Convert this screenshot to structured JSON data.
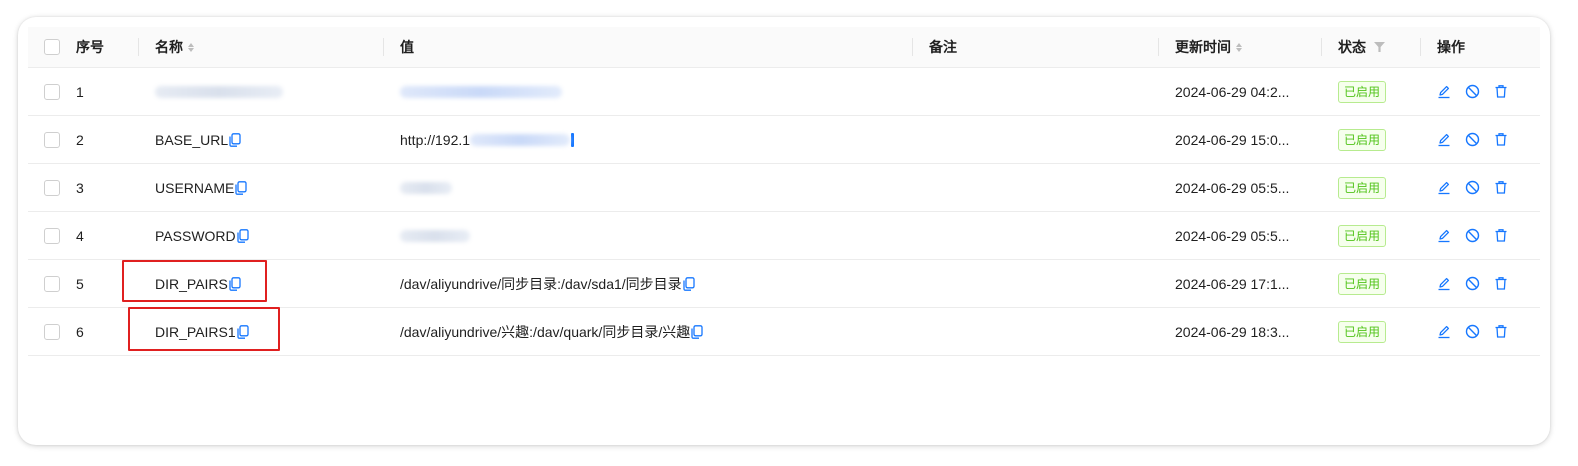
{
  "columns": {
    "index": "序号",
    "name": "名称",
    "value": "值",
    "note": "备注",
    "updated": "更新时间",
    "status": "状态",
    "actions": "操作"
  },
  "rows": [
    {
      "index": "1",
      "name": "",
      "value": "",
      "note": "",
      "updated": "2024-06-29 04:2...",
      "status": "已启用"
    },
    {
      "index": "2",
      "name": "BASE_URL",
      "value": "http://192.1",
      "note": "",
      "updated": "2024-06-29 15:0...",
      "status": "已启用"
    },
    {
      "index": "3",
      "name": "USERNAME",
      "value": "",
      "note": "",
      "updated": "2024-06-29 05:5...",
      "status": "已启用"
    },
    {
      "index": "4",
      "name": "PASSWORD",
      "value": "",
      "note": "",
      "updated": "2024-06-29 05:5...",
      "status": "已启用"
    },
    {
      "index": "5",
      "name": "DIR_PAIRS",
      "value": "/dav/aliyundrive/同步目录:/dav/sda1/同步目录",
      "note": "",
      "updated": "2024-06-29 17:1...",
      "status": "已启用"
    },
    {
      "index": "6",
      "name": "DIR_PAIRS1",
      "value": "/dav/aliyundrive/兴趣:/dav/quark/同步目录/兴趣",
      "note": "",
      "updated": "2024-06-29 18:3...",
      "status": "已启用"
    }
  ],
  "icons": {
    "copy": "copy-icon",
    "edit": "edit-icon",
    "disable": "disable-icon",
    "delete": "delete-icon",
    "sort": "sort-icon",
    "filter": "filter-icon"
  },
  "colors": {
    "accent": "#1677ff",
    "status_text": "#52c41a",
    "status_bg": "#f6ffed",
    "status_border": "#b7eb8f",
    "highlight": "#e02020"
  }
}
